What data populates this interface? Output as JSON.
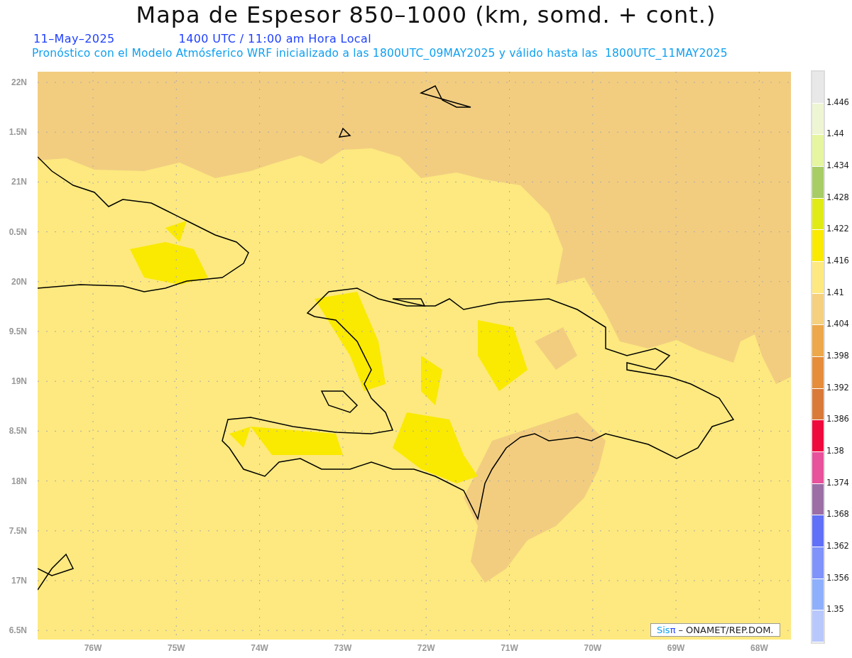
{
  "title": "Mapa de Espesor 850–1000 (km, somd. + cont.)",
  "date": "11–May–2025",
  "time_line": "1400 UTC / 11:00 am Hora Local",
  "subtitle": "Pronóstico con el Modelo Atmósferico WRF inicializado a las 1800UTC_09MAY2025 y válido hasta las  1800UTC_11MAY2025",
  "map": {
    "lat_labels": [
      "22N",
      "1.5N",
      "21N",
      "0.5N",
      "20N",
      "9.5N",
      "19N",
      "8.5N",
      "18N",
      "7.5N",
      "17N",
      "6.5N"
    ],
    "lon_labels": [
      "76W",
      "75W",
      "74W",
      "73W",
      "72W",
      "71W",
      "70W",
      "69W",
      "68W"
    ],
    "credit": {
      "brand_prefix": "Sis",
      "brand_symbol": "π",
      "text": "– ONAMET/REP.DOM."
    }
  },
  "legend": {
    "bins": [
      {
        "color": "#e8e8e8"
      },
      {
        "color": "#eef5d2"
      },
      {
        "color": "#e6f5a0"
      },
      {
        "color": "#a8cc66"
      },
      {
        "color": "#e0eb16"
      },
      {
        "color": "#fae900"
      },
      {
        "color": "#fde97f"
      },
      {
        "color": "#f4d07f"
      },
      {
        "color": "#eca84a"
      },
      {
        "color": "#e58d3a"
      },
      {
        "color": "#d97a38"
      },
      {
        "color": "#ef0a3e"
      },
      {
        "color": "#e8519b"
      },
      {
        "color": "#9b6fa6"
      },
      {
        "color": "#6070f7"
      },
      {
        "color": "#7f93fa"
      },
      {
        "color": "#8eb0fc"
      },
      {
        "color": "#b9c8fc"
      }
    ],
    "labels": [
      "1.446",
      "1.44",
      "1.434",
      "1.428",
      "1.422",
      "1.416",
      "1.41",
      "1.404",
      "1.398",
      "1.392",
      "1.386",
      "1.38",
      "1.374",
      "1.368",
      "1.362",
      "1.356",
      "1.35"
    ]
  }
}
